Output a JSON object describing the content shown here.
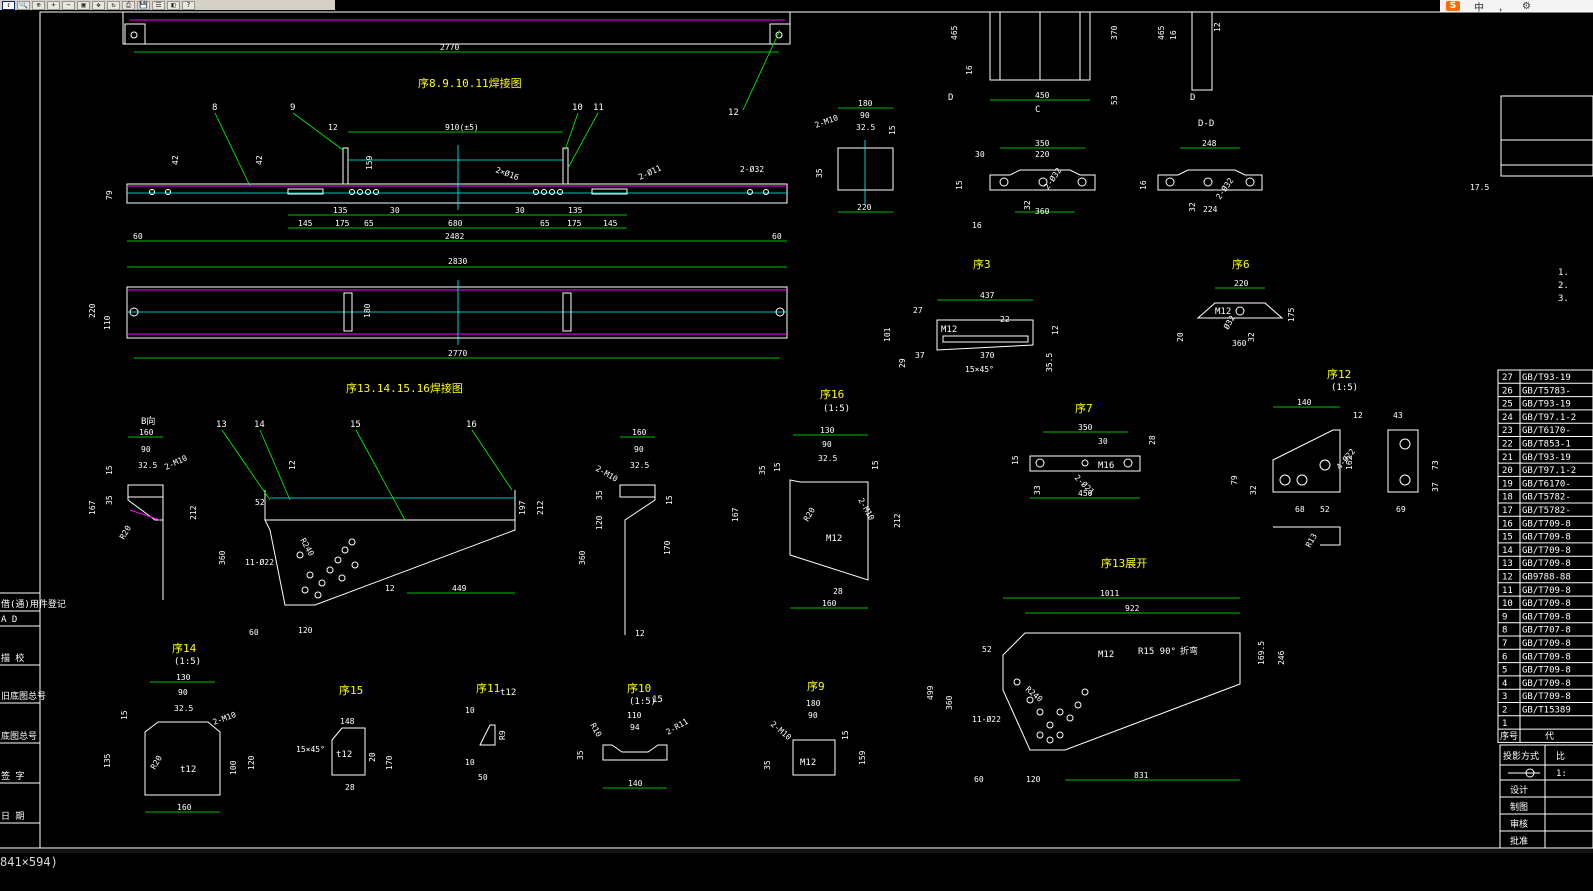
{
  "toolbar": {
    "buttons": [
      "zoom-realtime",
      "zoom-window",
      "zoom-prev",
      "zoom-in",
      "zoom-out",
      "zoom-all",
      "pan",
      "redraw",
      "print",
      "save",
      "properties",
      "layer",
      "help"
    ]
  },
  "ime": {
    "logo": "S",
    "mode": "中",
    "punct": "，"
  },
  "status": {
    "paper_size": "841×594)"
  },
  "colors": {
    "line": "#ffffff",
    "dim": "#00ff00",
    "center": "#00ffff",
    "text": "#ffff00",
    "hidden": "#ff00ff",
    "title_text": "#ffff00"
  },
  "titles": {
    "weld_8_11": "序8.9.10.11焊接图",
    "weld_13_16": "序13.14.15.16焊接图",
    "seq3": "序3",
    "seq6": "序6",
    "seq7": "序7",
    "seq12": "序12",
    "seq16": "序16",
    "seq13_unfold": "序13展开",
    "seq14": "序14",
    "seq15": "序15",
    "seq11": "序11",
    "seq10": "序10",
    "seq9": "序9",
    "scale_15": "(1:5)",
    "section_dd": "D-D",
    "view_b": "B向"
  },
  "dims": {
    "top_2770": "2770",
    "beam_910": "910(±5)",
    "beam_12": "12",
    "beam_42a": "42",
    "beam_42b": "42",
    "beam_159": "159",
    "beam_79": "79",
    "beam_2x32": "2-Ø32",
    "beam_2x16": "2×Ø16",
    "beam_2x11": "2-Ø11",
    "beam_135a": "135",
    "beam_30a": "30",
    "beam_30b": "30",
    "beam_135b": "135",
    "beam_145a": "145",
    "beam_175a": "175",
    "beam_65a": "65",
    "beam_680": "680",
    "beam_65b": "65",
    "beam_175b": "175",
    "beam_145b": "145",
    "beam_60a": "60",
    "beam_2482": "2482",
    "beam_60b": "60",
    "plan_2830": "2830",
    "plan_220": "220",
    "plan_110": "110",
    "plan_180": "180",
    "plan_2770": "2770",
    "d_180": "180",
    "d_90": "90",
    "d_325": "32.5",
    "d_2m10": "2-M10",
    "d_15": "15",
    "d_35": "35",
    "d_220": "220",
    "c_465": "465",
    "c_16a": "16",
    "c_450": "450",
    "c_370": "370",
    "c_53": "53",
    "c_D": "D",
    "c_C": "C",
    "e_465": "465",
    "e_16": "16",
    "e_12": "12",
    "e_D": "D",
    "sec_350": "350",
    "sec_220": "220",
    "sec_30": "30",
    "sec_15": "15",
    "sec_32": "32",
    "sec_360": "360",
    "sec_2x32": "2-Ø32",
    "sec_16": "16",
    "dd_248": "248",
    "dd_16": "16",
    "dd_32": "32",
    "dd_224": "224",
    "dd_2x32": "2-Ø32",
    "s3_437": "437",
    "s3_27": "27",
    "s3_22": "22",
    "s3_M12": "M12",
    "s3_101": "101",
    "s3_37": "37",
    "s3_370": "370",
    "s3_29": "29",
    "s3_15x45": "15×45°",
    "s3_355": "35.5",
    "s3_12": "12",
    "s6_220": "220",
    "s6_M12": "M12",
    "s6_175": "175",
    "s6_20": "20",
    "s6_360": "360",
    "s6_32": "32",
    "s6_o32": "Ø32",
    "b_160": "160",
    "b_90": "90",
    "b_325": "32.5",
    "b_15": "15",
    "b_2m10": "2-M10",
    "b_35": "35",
    "b_167": "167",
    "b_212": "212",
    "b_R20": "R20",
    "w_52": "52",
    "w_12a": "12",
    "w_60": "60",
    "w_R40": "R240",
    "w_360": "360",
    "w_11x22": "11-Ø22",
    "w_120": "120",
    "w_449": "449",
    "w_12b": "12",
    "w_212": "212",
    "w_197": "197",
    "b2_160": "160",
    "b2_90": "90",
    "b2_325": "32.5",
    "b2_2m10": "2-M10",
    "b2_35": "35",
    "b2_120": "120",
    "b2_360": "360",
    "b2_170": "170",
    "b2_12": "12",
    "b2_15": "15",
    "s16_130": "130",
    "s16_90": "90",
    "s16_325": "32.5",
    "s16_15a": "15",
    "s16_15b": "15",
    "s16_35": "35",
    "s16_167": "167",
    "s16_212": "212",
    "s16_R20": "R20",
    "s16_2m10": "2-M10",
    "s16_M12": "M12",
    "s16_28": "28",
    "s16_160": "160",
    "s7_350": "350",
    "s7_30": "30",
    "s7_28": "28",
    "s7_M16": "M16",
    "s7_2x21": "2-Ø21",
    "s7_33": "33",
    "s7_450": "450",
    "s7_15": "15",
    "s12_140": "140",
    "s12_12": "12",
    "s12_43": "43",
    "s12_162": "162",
    "s12_4x22": "4-Ø22",
    "s12_79": "79",
    "s12_32": "32",
    "s12_68": "68",
    "s12_52": "52",
    "s12_69": "69",
    "s12_73": "73",
    "s12_37": "37",
    "s12_R13": "R13",
    "u_1011": "1011",
    "u_922": "922",
    "u_52": "52",
    "u_M12": "M12",
    "u_R15": "R15 90°",
    "u_fold": "折弯",
    "u_1695": "169.5",
    "u_246": "246",
    "u_499": "499",
    "u_360": "360",
    "u_R240": "R240",
    "u_11x22": "11-Ø22",
    "u_60": "60",
    "u_120": "120",
    "u_831": "831",
    "s14_130": "130",
    "s14_90": "90",
    "s14_325": "32.5",
    "s14_15": "15",
    "s14_2m10": "2-M10",
    "s14_135": "135",
    "s14_R20": "R20",
    "s14_t12": "t12",
    "s14_100": "100",
    "s14_120": "120",
    "s14_160": "160",
    "s15_148": "148",
    "s15_15x45": "15×45°",
    "s15_t12": "t12",
    "s15_20": "20",
    "s15_170": "170",
    "s15_28": "28",
    "s11_10": "10",
    "s11_t12": "t12",
    "s11_R9": "R9",
    "s11_10b": "10",
    "s11_50": "50",
    "s10_110": "110",
    "s10_94": "94",
    "s10_R10": "R10",
    "s10_2r11": "2-R11",
    "s10_35": "35",
    "s10_15": "15",
    "s10_140": "140",
    "s9_180": "180",
    "s9_90": "90",
    "s9_2m10": "2-M10",
    "s9_35": "35",
    "s9_M12": "M12",
    "s9_159": "159",
    "s9_15": "15",
    "right_175": "17.5",
    "right_notes": [
      "1.",
      "2.",
      "3."
    ]
  },
  "balloons": {
    "b8": "8",
    "b9": "9",
    "b10": "10",
    "b11": "11",
    "b12": "12",
    "b13": "13",
    "b14": "14",
    "b15": "15",
    "b16": "16"
  },
  "left_title_block": {
    "rows": [
      "借(通)用件登记",
      "A  D",
      "描  校",
      "旧底图总号",
      "底图总号",
      "签  字",
      "日  期"
    ]
  },
  "bom": {
    "rows": [
      {
        "no": "27",
        "std": "GB/T93-19"
      },
      {
        "no": "26",
        "std": "GB/T5783-"
      },
      {
        "no": "25",
        "std": "GB/T93-19"
      },
      {
        "no": "24",
        "std": "GB/T97.1-2"
      },
      {
        "no": "23",
        "std": "GB/T6170-"
      },
      {
        "no": "22",
        "std": "GB/T853-1"
      },
      {
        "no": "21",
        "std": "GB/T93-19"
      },
      {
        "no": "20",
        "std": "GB/T97.1-2"
      },
      {
        "no": "19",
        "std": "GB/T6170-"
      },
      {
        "no": "18",
        "std": "GB/T5782-"
      },
      {
        "no": "17",
        "std": "GB/T5782-"
      },
      {
        "no": "16",
        "std": "GB/T709-8"
      },
      {
        "no": "15",
        "std": "GB/T709-8"
      },
      {
        "no": "14",
        "std": "GB/T709-8"
      },
      {
        "no": "13",
        "std": "GB/T709-8"
      },
      {
        "no": "12",
        "std": "GB9788-88"
      },
      {
        "no": "11",
        "std": "GB/T709-8"
      },
      {
        "no": "10",
        "std": "GB/T709-8"
      },
      {
        "no": "9",
        "std": "GB/T709-8"
      },
      {
        "no": "8",
        "std": "GB/T707-8"
      },
      {
        "no": "7",
        "std": "GB/T709-8"
      },
      {
        "no": "6",
        "std": "GB/T709-8"
      },
      {
        "no": "5",
        "std": "GB/T709-8"
      },
      {
        "no": "4",
        "std": "GB/T709-8"
      },
      {
        "no": "3",
        "std": "GB/T709-8"
      },
      {
        "no": "2",
        "std": "GB/T15389"
      },
      {
        "no": "1",
        "std": ""
      }
    ],
    "header_no": "序号",
    "header_name": "代"
  },
  "title_block": {
    "projection": "投影方式",
    "ratio_label": "比",
    "ratio": "1:",
    "design": "设计",
    "draw": "制图",
    "review": "审核",
    "approve": "批准"
  }
}
